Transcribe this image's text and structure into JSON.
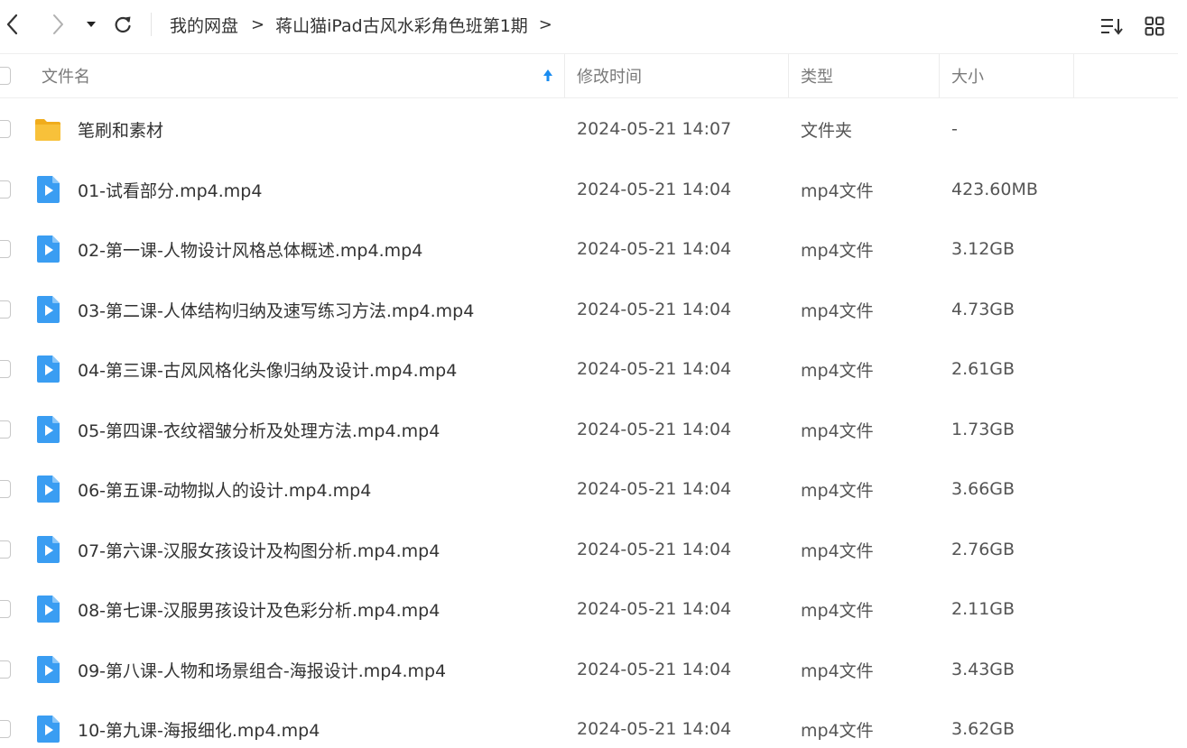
{
  "toolbar": {
    "back_icon": "chevron-left-icon",
    "forward_icon": "chevron-right-icon",
    "history_icon": "caret-down-icon",
    "refresh_icon": "refresh-icon",
    "sort_icon": "sort-list-icon",
    "view_icon": "grid-view-icon"
  },
  "breadcrumb": {
    "root": "我的网盘",
    "current": "蒋山猫iPad古风水彩角色班第1期",
    "separator": ">"
  },
  "table": {
    "headers": {
      "name": "文件名",
      "modified": "修改时间",
      "type": "类型",
      "size": "大小"
    },
    "sort_indicator": "ascending",
    "rows": [
      {
        "icon": "folder-icon",
        "name": "笔刷和素材",
        "modified": "2024-05-21 14:07",
        "type": "文件夹",
        "size": "-"
      },
      {
        "icon": "video-file-icon",
        "name": "01-试看部分.mp4.mp4",
        "modified": "2024-05-21 14:04",
        "type": "mp4文件",
        "size": "423.60MB"
      },
      {
        "icon": "video-file-icon",
        "name": "02-第一课-人物设计风格总体概述.mp4.mp4",
        "modified": "2024-05-21 14:04",
        "type": "mp4文件",
        "size": "3.12GB"
      },
      {
        "icon": "video-file-icon",
        "name": "03-第二课-人体结构归纳及速写练习方法.mp4.mp4",
        "modified": "2024-05-21 14:04",
        "type": "mp4文件",
        "size": "4.73GB"
      },
      {
        "icon": "video-file-icon",
        "name": "04-第三课-古风风格化头像归纳及设计.mp4.mp4",
        "modified": "2024-05-21 14:04",
        "type": "mp4文件",
        "size": "2.61GB"
      },
      {
        "icon": "video-file-icon",
        "name": "05-第四课-衣纹褶皱分析及处理方法.mp4.mp4",
        "modified": "2024-05-21 14:04",
        "type": "mp4文件",
        "size": "1.73GB"
      },
      {
        "icon": "video-file-icon",
        "name": "06-第五课-动物拟人的设计.mp4.mp4",
        "modified": "2024-05-21 14:04",
        "type": "mp4文件",
        "size": "3.66GB"
      },
      {
        "icon": "video-file-icon",
        "name": "07-第六课-汉服女孩设计及构图分析.mp4.mp4",
        "modified": "2024-05-21 14:04",
        "type": "mp4文件",
        "size": "2.76GB"
      },
      {
        "icon": "video-file-icon",
        "name": "08-第七课-汉服男孩设计及色彩分析.mp4.mp4",
        "modified": "2024-05-21 14:04",
        "type": "mp4文件",
        "size": "2.11GB"
      },
      {
        "icon": "video-file-icon",
        "name": "09-第八课-人物和场景组合-海报设计.mp4.mp4",
        "modified": "2024-05-21 14:04",
        "type": "mp4文件",
        "size": "3.43GB"
      },
      {
        "icon": "video-file-icon",
        "name": "10-第九课-海报细化.mp4.mp4",
        "modified": "2024-05-21 14:04",
        "type": "mp4文件",
        "size": "3.62GB"
      }
    ]
  },
  "colors": {
    "accent": "#1a8cf0",
    "folder": "#f8c13a",
    "video_icon": "#3a9df2",
    "text": "#333333",
    "muted": "#7a7a7a"
  }
}
